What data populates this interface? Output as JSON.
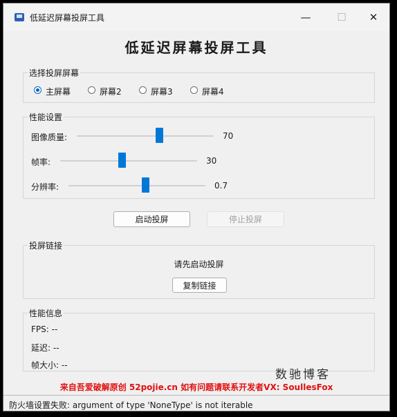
{
  "window": {
    "title": "低延迟屏幕投屏工具",
    "minimize": "—",
    "maximize": "☐",
    "close": "✕"
  },
  "app_title": "低延迟屏幕投屏工具",
  "screen_select": {
    "title": "选择投屏屏幕",
    "options": [
      {
        "label": "主屏幕",
        "checked": true
      },
      {
        "label": "屏幕2",
        "checked": false
      },
      {
        "label": "屏幕3",
        "checked": false
      },
      {
        "label": "屏幕4",
        "checked": false
      }
    ]
  },
  "performance": {
    "title": "性能设置",
    "sliders": [
      {
        "label": "图像质量:",
        "value": "70",
        "fraction": 0.6
      },
      {
        "label": "帧率:",
        "value": "30",
        "fraction": 0.45
      },
      {
        "label": "分辨率:",
        "value": "0.7",
        "fraction": 0.55
      }
    ]
  },
  "actions": {
    "start": "启动投屏",
    "stop": "停止投屏"
  },
  "link": {
    "title": "投屏链接",
    "status": "请先启动投屏",
    "copy": "复制链接"
  },
  "info": {
    "title": "性能信息",
    "fps": "FPS: --",
    "latency": "延迟: --",
    "frame_size": "帧大小: --"
  },
  "watermark": "数驰博客",
  "notice": "来自吾爱破解原创 52pojie.cn 如有问题请联系开发者VX: SoullesFox",
  "status_bar": "防火墙设置失败: argument of type 'NoneType' is not iterable",
  "colors": {
    "accent": "#0078d7",
    "notice": "#e01010"
  }
}
